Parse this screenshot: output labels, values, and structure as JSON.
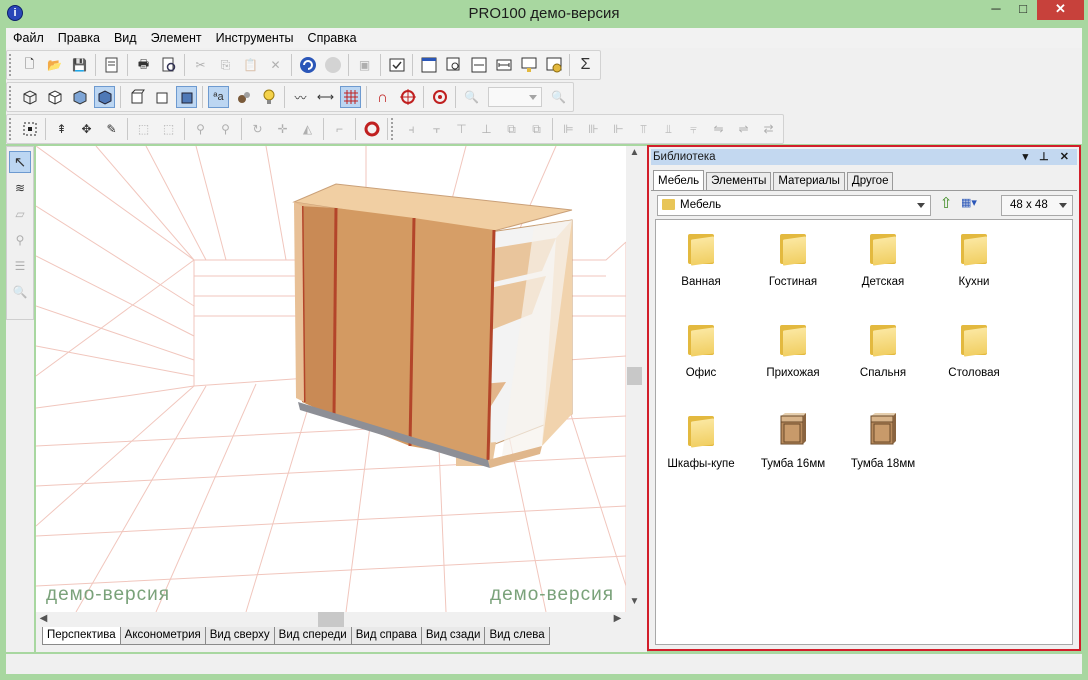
{
  "window": {
    "title": "PRO100 демо-версия",
    "min_glyph": "─",
    "max_glyph": "□",
    "close_glyph": "✕"
  },
  "menu": [
    "Файл",
    "Правка",
    "Вид",
    "Элемент",
    "Инструменты",
    "Справка"
  ],
  "viewport": {
    "watermark": "демо-версия"
  },
  "view_tabs": [
    "Перспектива",
    "Аксонометрия",
    "Вид сверху",
    "Вид спереди",
    "Вид справа",
    "Вид сзади",
    "Вид слева"
  ],
  "library": {
    "header": "Библиотека",
    "header_buttons": "▾ ⊥ ✕",
    "tabs": [
      "Мебель",
      "Элементы",
      "Материалы",
      "Другое"
    ],
    "folder": "Мебель",
    "size": "48 x  48",
    "up_glyph": "⇧",
    "view_glyph": "▦▾",
    "items": [
      {
        "label": "Ванная",
        "icon": "folder-icon"
      },
      {
        "label": "Гостиная",
        "icon": "folder-icon"
      },
      {
        "label": "Детская",
        "icon": "folder-icon"
      },
      {
        "label": "Кухни",
        "icon": "folder-icon"
      },
      {
        "label": "Офис",
        "icon": "folder-icon"
      },
      {
        "label": "Прихожая",
        "icon": "folder-icon"
      },
      {
        "label": "Спальня",
        "icon": "folder-icon"
      },
      {
        "label": "Столовая",
        "icon": "folder-icon"
      },
      {
        "label": "Шкафы-купе",
        "icon": "folder-icon"
      },
      {
        "label": "Тумба 16мм",
        "icon": "cabinet-icon"
      },
      {
        "label": "Тумба 18мм",
        "icon": "cabinet-icon"
      }
    ]
  },
  "colors": {
    "accent_frame": "#a8d7a0",
    "highlight_border": "#d21e2a",
    "wood": "#d9a06a",
    "door_edge": "#b3452a"
  },
  "icons": {
    "new": "🗋",
    "open": "📂",
    "save": "💾",
    "print": "🖶",
    "undo": "↶",
    "redo": "↷",
    "sum": "Σ",
    "select": "↖"
  }
}
